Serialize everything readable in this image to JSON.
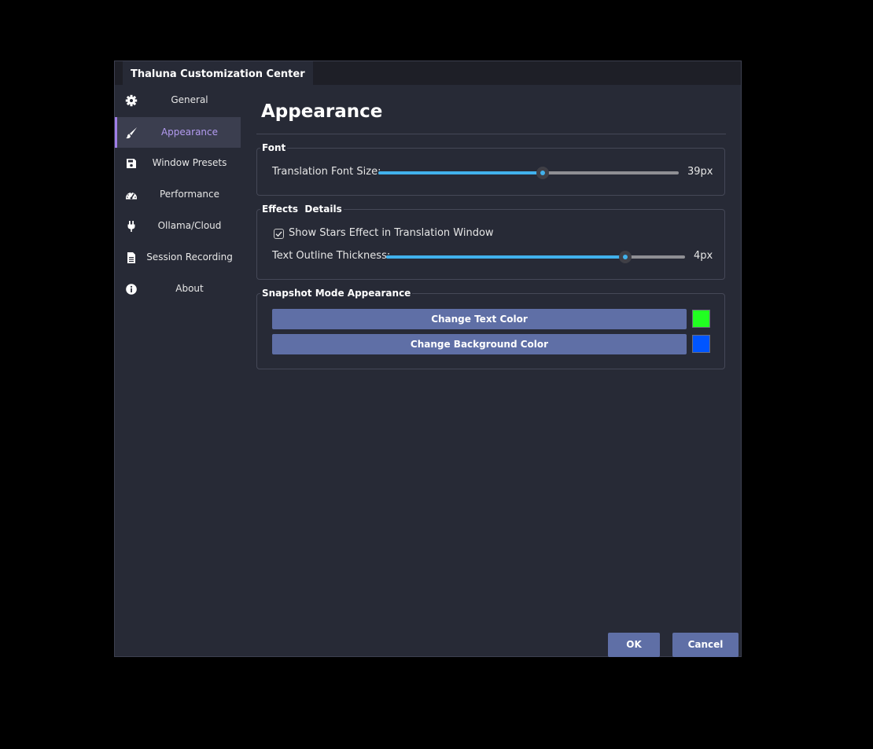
{
  "window": {
    "title": "Thaluna Customization Center"
  },
  "sidebar": {
    "items": [
      {
        "label": "General",
        "icon": "gear-icon"
      },
      {
        "label": "Appearance",
        "icon": "brush-icon",
        "active": true
      },
      {
        "label": "Window Presets",
        "icon": "floppy-disk-icon"
      },
      {
        "label": "Performance",
        "icon": "gauge-icon"
      },
      {
        "label": "Ollama/Cloud",
        "icon": "plug-icon"
      },
      {
        "label": "Session Recording",
        "icon": "document-icon"
      },
      {
        "label": "About",
        "icon": "info-icon"
      }
    ]
  },
  "page": {
    "title": "Appearance"
  },
  "font_group": {
    "title": "Font",
    "font_size_label": "Translation Font Size:",
    "font_size_value": "39px",
    "font_size_fraction": 0.548
  },
  "effects_group": {
    "title": "Effects  Details",
    "stars_checkbox_label": "Show Stars Effect in Translation Window",
    "stars_checked": true,
    "outline_label": "Text Outline Thickness:",
    "outline_value": "4px",
    "outline_fraction": 0.8
  },
  "snapshot_group": {
    "title": "Snapshot Mode Appearance",
    "text_color_button": "Change Text Color",
    "text_color": "#21ff21",
    "background_color_button": "Change Background Color",
    "background_color": "#0055ff"
  },
  "footer": {
    "ok_label": "OK",
    "cancel_label": "Cancel"
  },
  "colors": {
    "accent": "#41b1ec",
    "active_nav": "#b39bf0",
    "button": "#5f6fa6",
    "dialog_bg": "#272a36"
  }
}
